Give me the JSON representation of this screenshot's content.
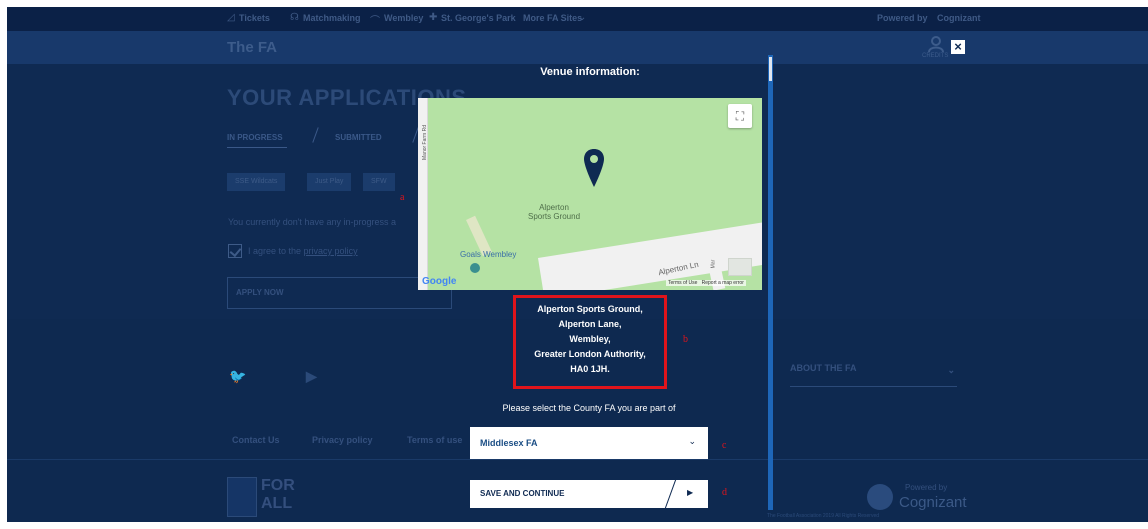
{
  "topbar": {
    "links": [
      "Tickets",
      "Matchmaking",
      "Wembley",
      "St. George's Park",
      "More FA Sites"
    ],
    "powered_by": "Powered by",
    "brand": "Cognizant"
  },
  "header": {
    "logo": "The FA",
    "user_label": "CREDITS"
  },
  "background_page": {
    "title": "YOUR APPLICATIONS",
    "tabs": [
      "IN PROGRESS",
      "SUBMITTED"
    ],
    "chips": [
      "SSE Wildcats",
      "Just Play",
      "SFW"
    ],
    "no_apps_text": "You currently don't have any in-progress a",
    "agree_prefix": "I agree to the ",
    "agree_link": "privacy policy",
    "apply_button": "APPLY NOW"
  },
  "footer": {
    "about": "ABOUT THE FA",
    "links": [
      "Contact Us",
      "Privacy policy",
      "Terms of use"
    ],
    "for_all_1": "FOR",
    "for_all_2": "ALL",
    "powered_by": "Powered by",
    "brand": "Cognizant",
    "copyright": "The Football Association 2019 All Rights Reserved"
  },
  "modal": {
    "title": "Venue information:",
    "map": {
      "venue_label_1": "Alperton",
      "venue_label_2": "Sports Ground",
      "poi_label": "Goals Wembley",
      "road_1": "Manor Farm Rd",
      "road_2": "Alperton Ln",
      "road_3": "Mar",
      "google": "Google",
      "terms": "Terms of Use",
      "report": "Report a map error"
    },
    "address_lines": [
      "Alperton Sports Ground,",
      "Alperton Lane,",
      "Wembley,",
      "Greater London Authority,",
      "HA0 1JH."
    ],
    "county_label": "Please select the County FA you are part of",
    "county_value": "Middlesex FA",
    "save_button": "SAVE AND CONTINUE"
  },
  "annotations": {
    "a": "a",
    "b": "b",
    "c": "c",
    "d": "d"
  },
  "colors": {
    "navy": "#0f2a52",
    "accent_blue": "#1e66b8",
    "highlight_red": "#e0141b",
    "map_green": "#b5e2a4"
  }
}
